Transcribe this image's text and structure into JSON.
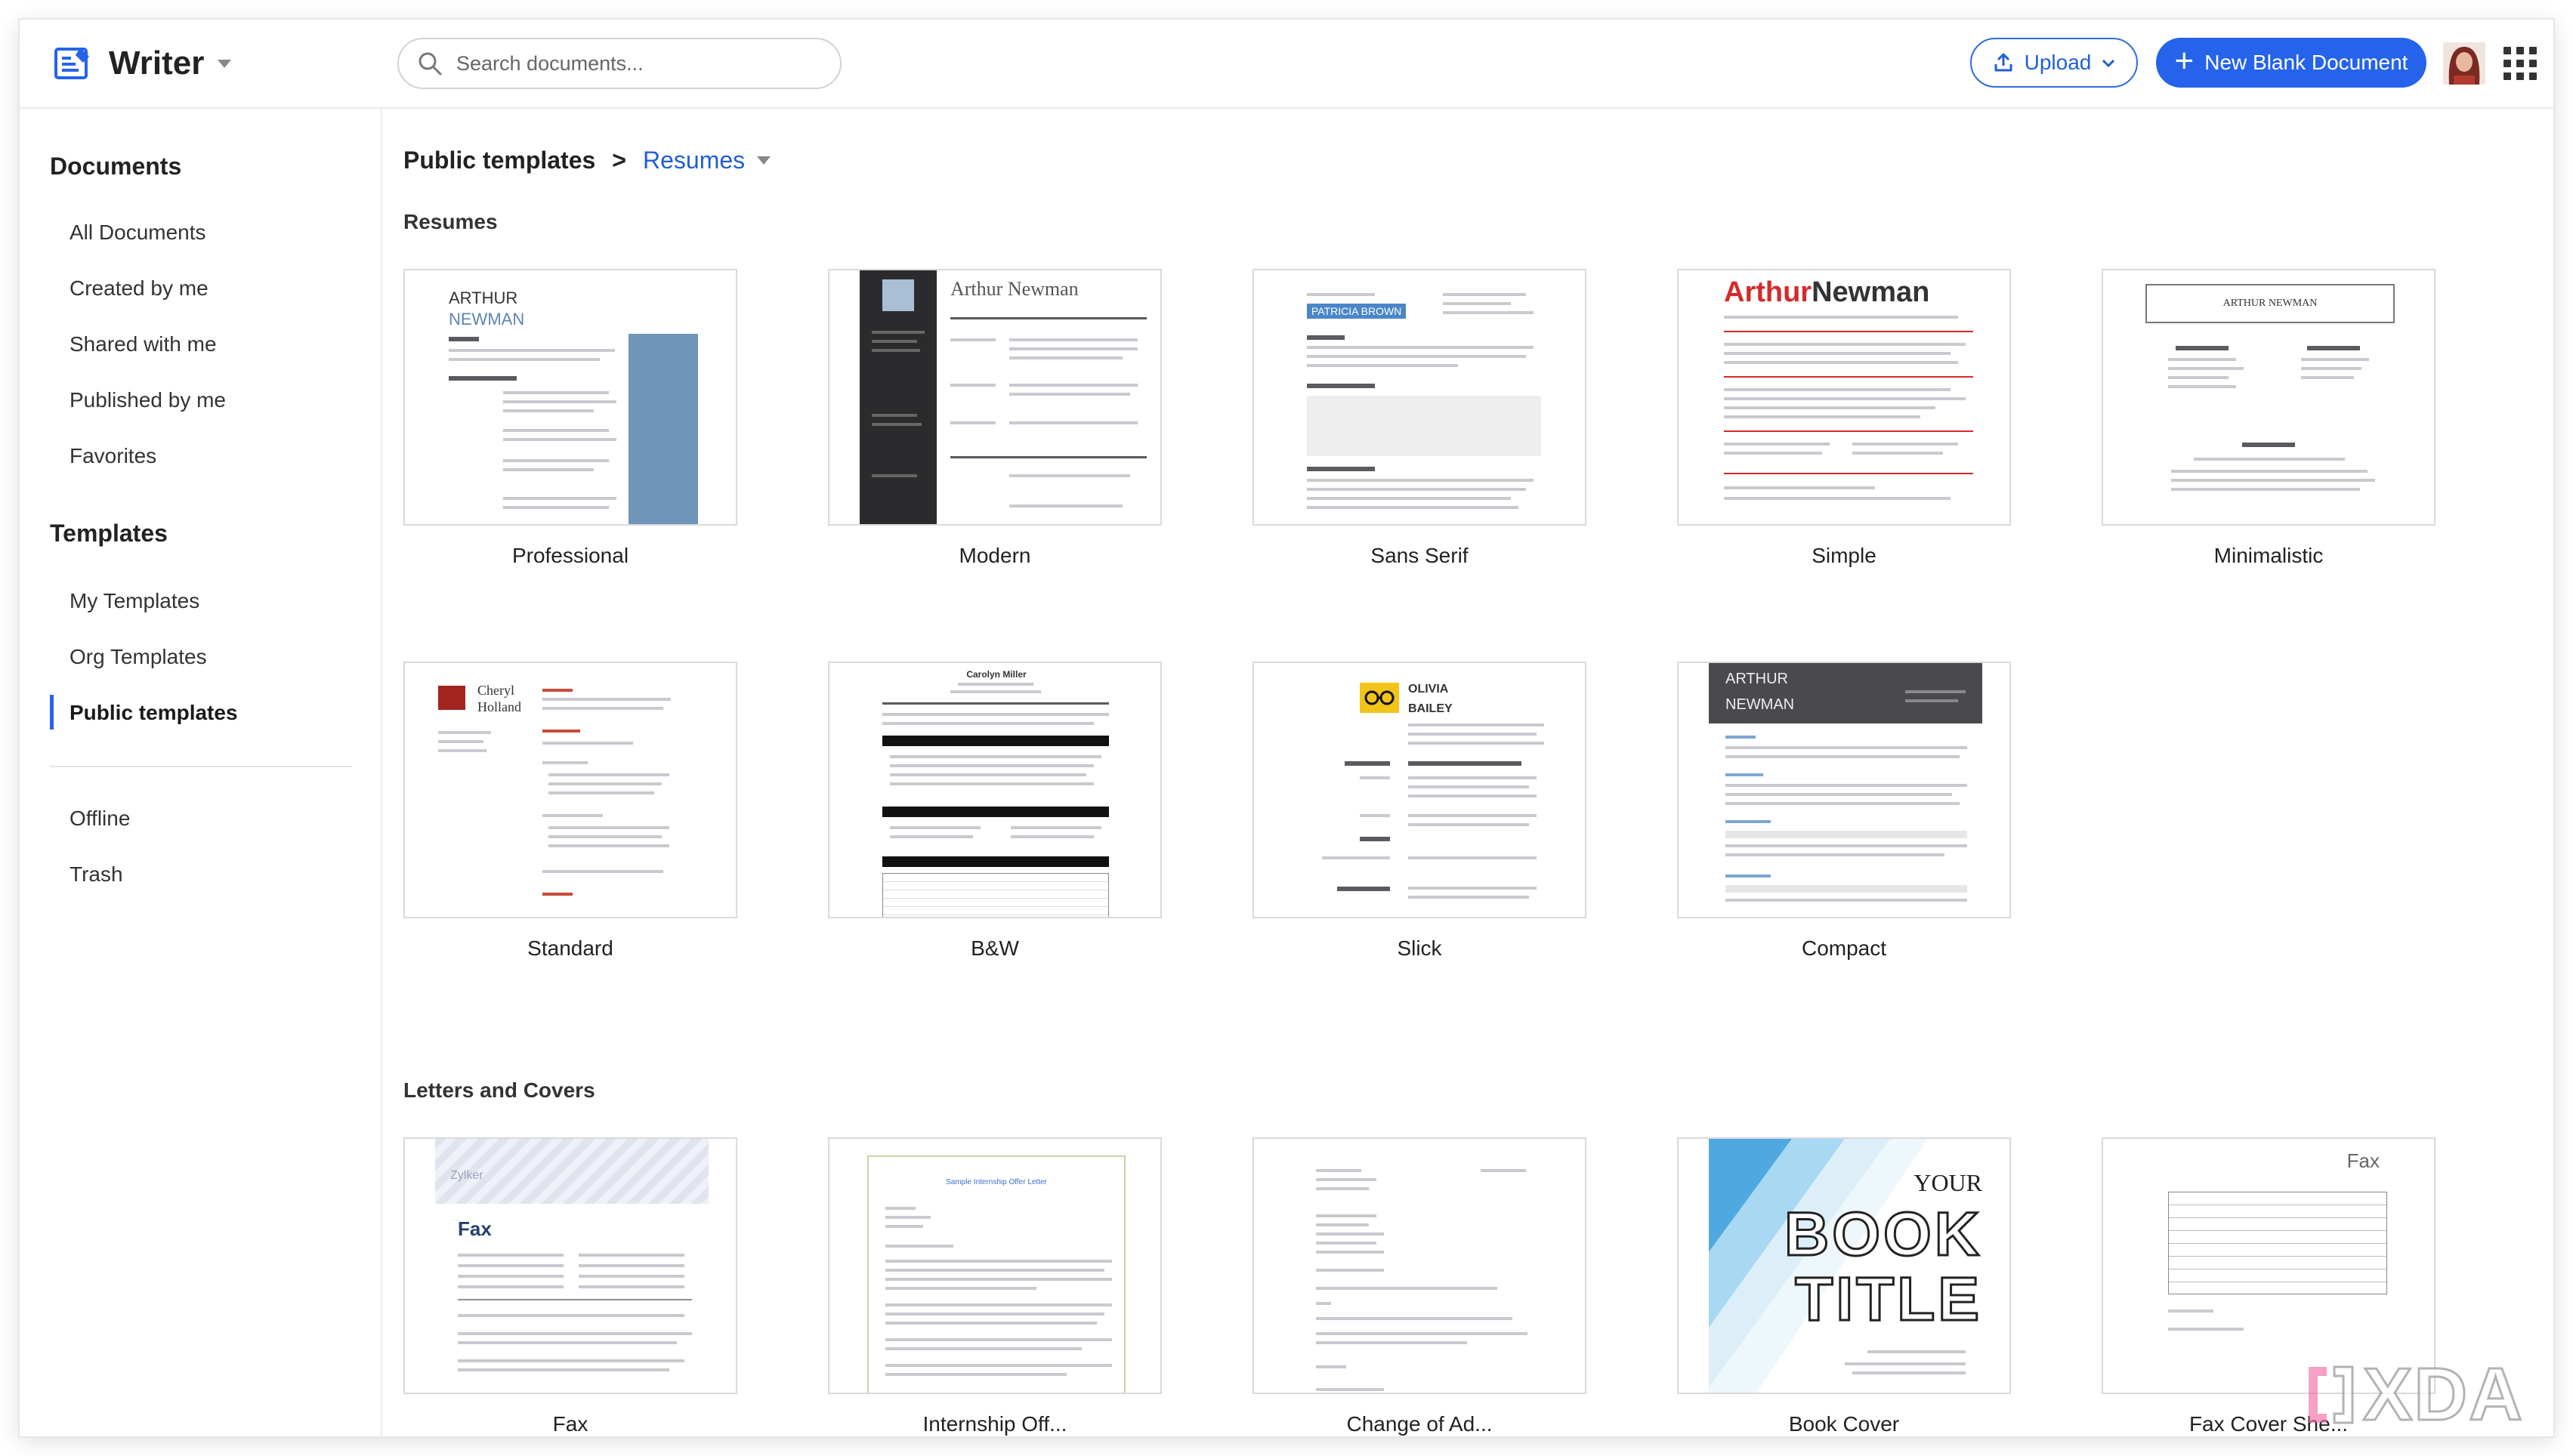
{
  "app": {
    "name": "Writer"
  },
  "search": {
    "placeholder": "Search documents..."
  },
  "toolbar": {
    "upload_label": "Upload",
    "new_label": "New Blank Document"
  },
  "sidebar": {
    "documents_heading": "Documents",
    "documents": [
      {
        "label": "All Documents"
      },
      {
        "label": "Created by me"
      },
      {
        "label": "Shared with me"
      },
      {
        "label": "Published by me"
      },
      {
        "label": "Favorites"
      }
    ],
    "templates_heading": "Templates",
    "templates": [
      {
        "label": "My Templates"
      },
      {
        "label": "Org Templates"
      },
      {
        "label": "Public templates",
        "active": true
      }
    ],
    "other": [
      {
        "label": "Offline"
      },
      {
        "label": "Trash"
      }
    ]
  },
  "breadcrumb": {
    "root": "Public templates",
    "separator": ">",
    "current": "Resumes"
  },
  "sections": {
    "resumes": {
      "title": "Resumes",
      "cards": [
        {
          "label": "Professional"
        },
        {
          "label": "Modern"
        },
        {
          "label": "Sans Serif"
        },
        {
          "label": "Simple"
        },
        {
          "label": "Minimalistic"
        },
        {
          "label": "Standard"
        },
        {
          "label": "B&W"
        },
        {
          "label": "Slick"
        },
        {
          "label": "Compact"
        }
      ]
    },
    "letters": {
      "title": "Letters and Covers",
      "cards": [
        {
          "label": "Fax"
        },
        {
          "label": "Internship Off..."
        },
        {
          "label": "Change of Ad..."
        },
        {
          "label": "Book Cover"
        },
        {
          "label": "Fax Cover She..."
        }
      ]
    }
  },
  "thumbnail_text": {
    "professional_name_1": "ARTHUR",
    "professional_name_2": "NEWMAN",
    "modern_name": "Arthur Newman",
    "sans_serif_name": "PATRICIA BROWN",
    "simple_name_1": "Arthur",
    "simple_name_2": "Newman",
    "minimalistic_name": "ARTHUR NEWMAN",
    "standard_name_1": "Cheryl",
    "standard_name_2": "Holland",
    "bw_name": "Carolyn Miller",
    "slick_name_1": "OLIVIA",
    "slick_name_2": "BAILEY",
    "compact_name_1": "ARTHUR",
    "compact_name_2": "NEWMAN",
    "fax_brand": "Zylker",
    "fax_title": "Fax",
    "internship_title": "Sample Internship Offer Letter",
    "book_line_1": "YOUR",
    "book_line_2": "BOOK",
    "book_line_3": "TITLE",
    "fax_cover_title": "Fax"
  },
  "watermark": {
    "text": "XDA"
  },
  "colors": {
    "accent": "#2563eb",
    "link": "#1f5fd6",
    "simple_red": "#d42a2a",
    "professional_blue": "#6f95b8"
  }
}
